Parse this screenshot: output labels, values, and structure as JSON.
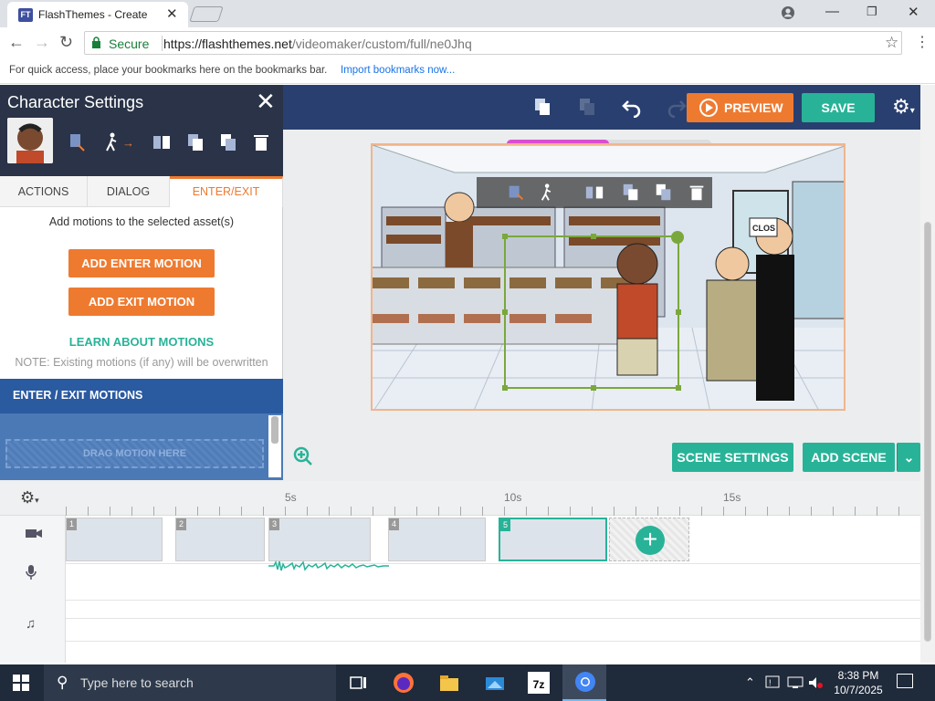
{
  "browser": {
    "tab_title": "FlashThemes - Create",
    "favicon_text": "FT",
    "secure_label": "Secure",
    "url_host": "https://flashthemes.net",
    "url_path": "/videomaker/custom/full/ne0Jhq",
    "bookmarks_hint": "For quick access, place your bookmarks here on the bookmarks bar.",
    "import_link": "Import bookmarks now..."
  },
  "toolbar": {
    "preview_label": "PREVIEW",
    "save_label": "SAVE"
  },
  "character_panel": {
    "title": "Character Settings",
    "tabs": [
      {
        "label": "ACTIONS"
      },
      {
        "label": "DIALOG"
      },
      {
        "label": "ENTER/EXIT"
      }
    ],
    "active_tab": "ENTER/EXIT",
    "hint": "Add motions to the selected asset(s)",
    "add_enter_label": "ADD ENTER MOTION",
    "add_exit_label": "ADD EXIT MOTION",
    "learn_label": "LEARN ABOUT MOTIONS",
    "note": "NOTE: Existing motions (if any) will be overwritten",
    "motions_header": "ENTER / EXIT MOTIONS",
    "drag_placeholder": "DRAG MOTION HERE"
  },
  "stage": {
    "scene_settings_label": "SCENE SETTINGS",
    "add_scene_label": "ADD SCENE",
    "sign_text": "CLOS",
    "loading_progress": 0.5
  },
  "timeline": {
    "ruler_labels": [
      "5s",
      "10s",
      "15s"
    ],
    "scenes": [
      {
        "num": "1",
        "selected": false
      },
      {
        "num": "2",
        "selected": false
      },
      {
        "num": "3",
        "selected": false
      },
      {
        "num": "4",
        "selected": false
      },
      {
        "num": "5",
        "selected": true
      }
    ]
  },
  "taskbar": {
    "search_placeholder": "Type here to search",
    "time": "8:38 PM",
    "date": "10/7/2025",
    "sevenzip_label": "7z"
  },
  "colors": {
    "accent_orange": "#ee7a30",
    "accent_teal": "#28b398",
    "header_navy": "#293f6f",
    "panel_dark": "#2a3347"
  },
  "icons": [
    "lock-icon",
    "star-icon",
    "copy-icon",
    "paste-icon",
    "undo-icon",
    "redo-icon",
    "gear-icon",
    "close-icon",
    "walk-icon",
    "flip-icon",
    "delete-icon",
    "zoom-in-icon",
    "camera-icon",
    "mic-icon",
    "music-note-icon",
    "plus-icon",
    "windows-icon",
    "search-icon"
  ]
}
